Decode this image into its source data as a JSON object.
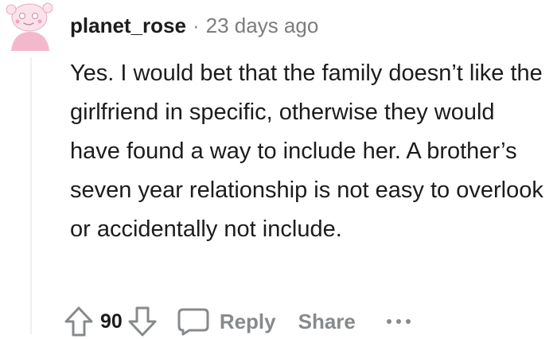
{
  "comment": {
    "author": "planet_rose",
    "separator": "·",
    "timestamp": "23 days ago",
    "body": "Yes. I would bet that the family doesn’t like the girlfriend in specific, otherwise they would have found a way to include her. A brother’s seven year relationship is not easy to overlook or accidentally not include.",
    "score": "90",
    "reply_label": "Reply",
    "share_label": "Share"
  },
  "icons": {
    "avatar": "snoo-avatar-icon",
    "upvote": "upvote-arrow-icon",
    "downvote": "downvote-arrow-icon",
    "reply": "comment-bubble-icon",
    "more": "more-options-icon"
  },
  "colors": {
    "text": "#1c1c1c",
    "meta": "#7c7c7c",
    "action": "#878a8c",
    "avatar_pink": "#f4b8cd",
    "thread_line": "#edeff1"
  }
}
